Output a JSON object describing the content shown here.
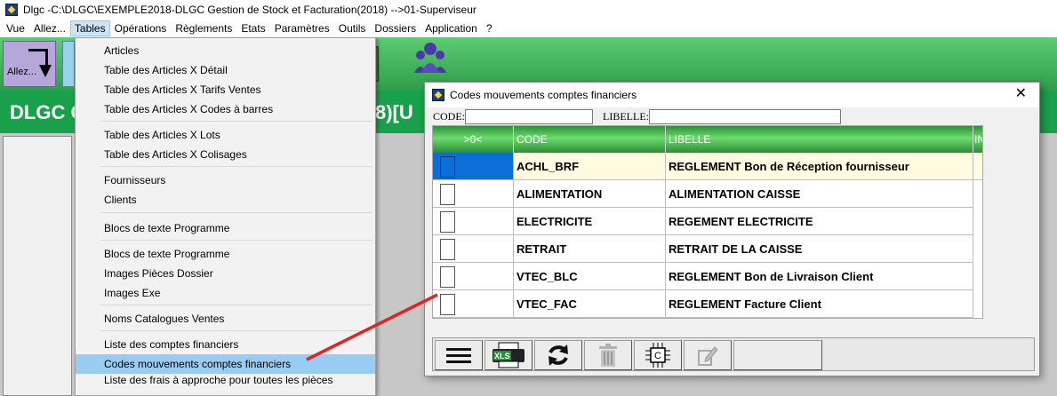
{
  "window": {
    "title": "Dlgc -C:\\DLGC\\EXEMPLE2018-DLGC Gestion de Stock et Facturation(2018) -->01-Superviseur",
    "icon": "app-icon"
  },
  "menubar": {
    "items": [
      "Vue",
      "Allez...",
      "Tables",
      "Opérations",
      "Règlements",
      "Etats",
      "Paramètres",
      "Outils",
      "Dossiers",
      "Application",
      "?"
    ],
    "active": "Tables"
  },
  "toolbar": {
    "allez_label": "Allez..."
  },
  "banner": {
    "left_text": "DLGC G",
    "right_text": "8)[U"
  },
  "tables_menu": {
    "items": [
      "Articles",
      "Table des Articles X Détail",
      "Table des Articles X Tarifs Ventes",
      "Table des Articles X Codes à barres",
      "Table des Articles X Lots",
      "Table des Articles X Colisages",
      "Fournisseurs",
      "Clients",
      "Blocs de texte Programme",
      "Blocs de texte Programme",
      "Images Pièces Dossier",
      "Images Exe",
      "Noms Catalogues Ventes",
      "Liste des comptes financiers",
      "Codes mouvements comptes financiers",
      "Liste des frais à approche pour toutes les pièces"
    ],
    "highlighted": "Codes mouvements comptes financiers"
  },
  "dialog": {
    "title": "Codes mouvements comptes financiers",
    "close_glyph": "✕",
    "filter_code_label": "CODE:",
    "filter_code_value": "",
    "filter_libelle_label": "LIBELLE:",
    "filter_libelle_value": "",
    "grid": {
      "columns": [
        ">0<",
        "CODE",
        "LIBELLE",
        "IN"
      ],
      "rows": [
        {
          "code": "ACHL_BRF",
          "libelle": "REGLEMENT Bon de Réception fournisseur",
          "selected": true
        },
        {
          "code": "ALIMENTATION",
          "libelle": "ALIMENTATION CAISSE",
          "selected": false
        },
        {
          "code": "ELECTRICITE",
          "libelle": "REGEMENT ELECTRICITE",
          "selected": false
        },
        {
          "code": "RETRAIT",
          "libelle": "RETRAIT DE LA CAISSE",
          "selected": false
        },
        {
          "code": "VTEC_BLC",
          "libelle": "REGLEMENT Bon de Livraison Client",
          "selected": false
        },
        {
          "code": "VTEC_FAC",
          "libelle": "REGLEMENT Facture Client",
          "selected": false
        }
      ]
    },
    "buttons": [
      {
        "name": "menu-button",
        "icon": "hamburger-icon"
      },
      {
        "name": "export-xls-button",
        "icon": "xls-printer-icon",
        "icon_text": "XLS"
      },
      {
        "name": "refresh-button",
        "icon": "refresh-icon"
      },
      {
        "name": "delete-button",
        "icon": "trash-icon"
      },
      {
        "name": "config-button",
        "icon": "chip-c-icon",
        "icon_text": "C"
      },
      {
        "name": "edit-button",
        "icon": "edit-pencil-icon"
      }
    ]
  },
  "colors": {
    "header_green": "#2d8f38",
    "banner_green": "#19a04a",
    "selection_blue": "#0a6fd6",
    "menu_highlight": "#99ccf3",
    "annotation_red": "#e02424"
  }
}
